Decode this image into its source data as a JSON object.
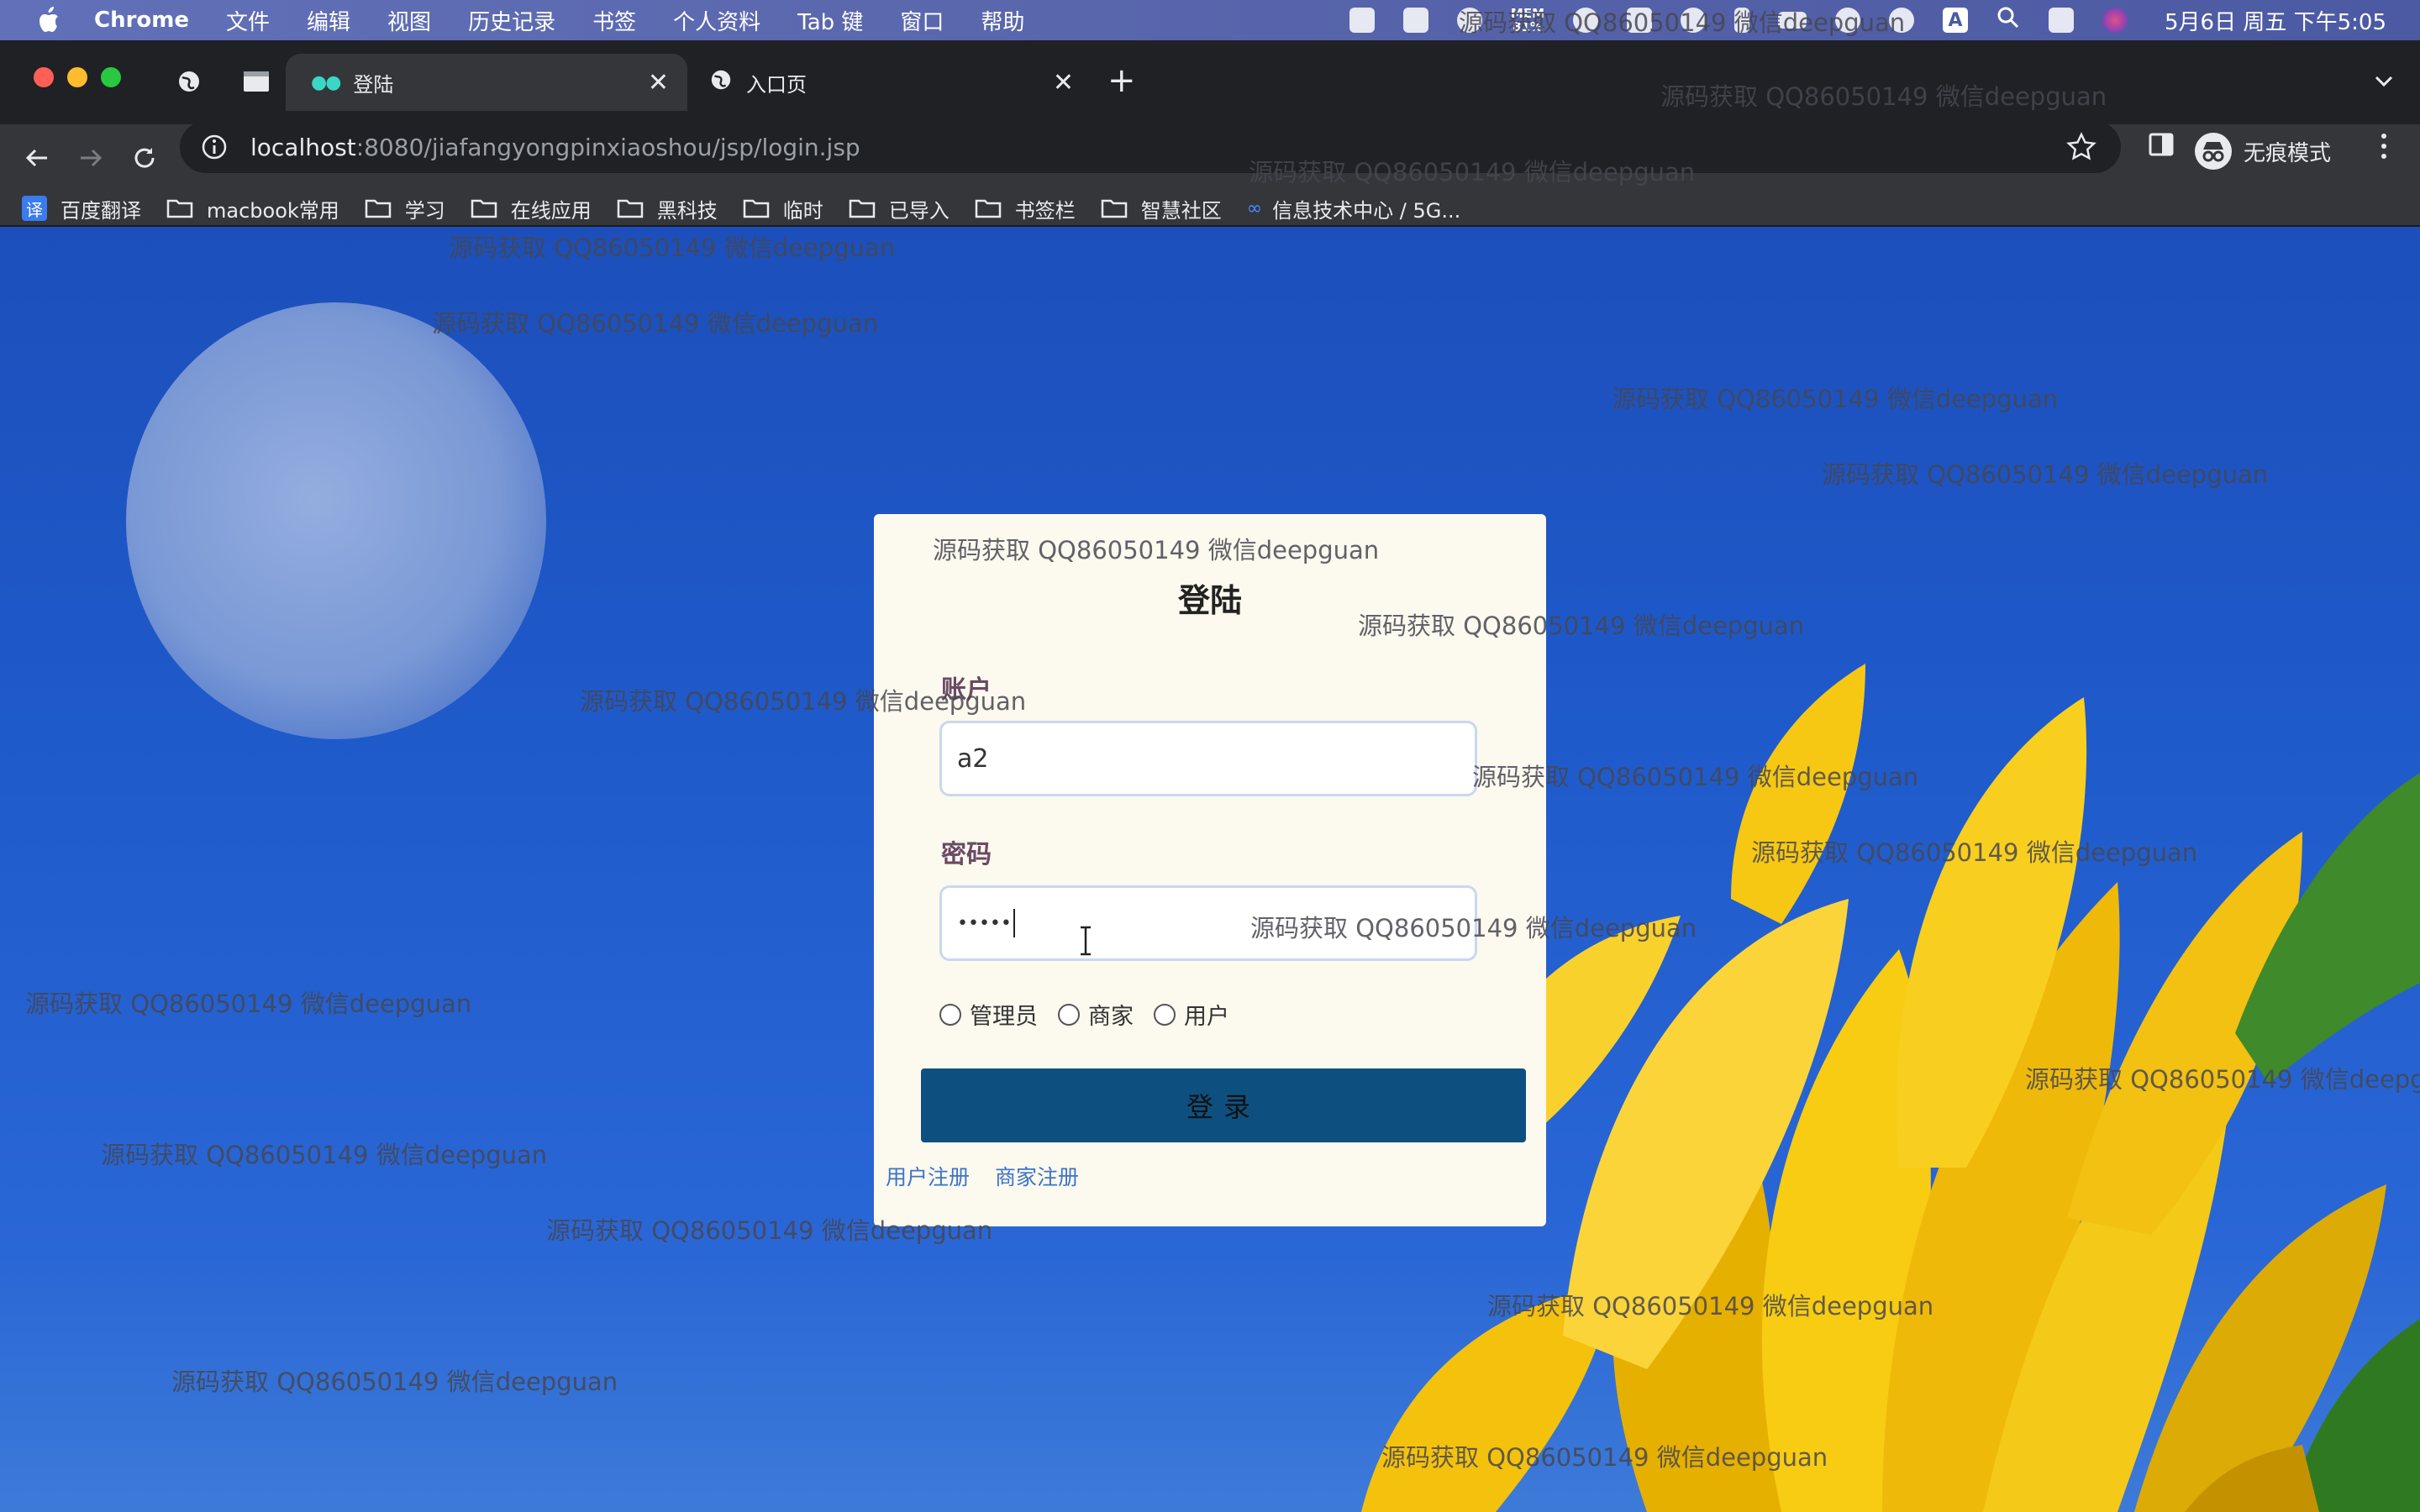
{
  "menubar": {
    "app": "Chrome",
    "items": [
      "文件",
      "编辑",
      "视图",
      "历史记录",
      "书签",
      "个人资料",
      "Tab 键",
      "窗口",
      "帮助"
    ],
    "mem_label": "MEM",
    "mem_value": "81%",
    "input_method": "A",
    "clock": "5月6日 周五 下午5:05"
  },
  "tabs": [
    {
      "title": "登陆",
      "active": true,
      "icon": "dots-icon"
    },
    {
      "title": "入口页",
      "active": false,
      "icon": "globe-icon"
    }
  ],
  "toolbar": {
    "url_host": "localhost",
    "url_rest": ":8080/jiafangyongpinxiaoshou/jsp/login.jsp",
    "incognito_label": "无痕模式"
  },
  "bookmarks": [
    {
      "label": "百度翻译",
      "icon": "fanyi-icon",
      "badge": "译"
    },
    {
      "label": "macbook常用",
      "icon": "folder-icon"
    },
    {
      "label": "学习",
      "icon": "folder-icon"
    },
    {
      "label": "在线应用",
      "icon": "folder-icon"
    },
    {
      "label": "黑科技",
      "icon": "folder-icon"
    },
    {
      "label": "临时",
      "icon": "folder-icon"
    },
    {
      "label": "已导入",
      "icon": "folder-icon"
    },
    {
      "label": "书签栏",
      "icon": "folder-icon"
    },
    {
      "label": "智慧社区",
      "icon": "folder-icon"
    },
    {
      "label": "信息技术中心 / 5G...",
      "icon": "infinity-icon",
      "glyph": "∞"
    }
  ],
  "login": {
    "title": "登陆",
    "account_label": "账户",
    "account_value": "a2",
    "password_label": "密码",
    "password_value": "•••••",
    "roles": [
      "管理员",
      "商家",
      "用户"
    ],
    "submit_label": "登录",
    "links": [
      "用户注册",
      "商家注册"
    ]
  },
  "watermark": "源码获取 QQ86050149 微信deepguan",
  "colors": {
    "menubar": "#5a67ad",
    "tabstrip": "#202124",
    "toolbar": "#35363a",
    "sky": "#1f5acb",
    "card": "#fcf9ee",
    "button": "#0d5080",
    "link": "#3b74c9",
    "label": "#6a4a64"
  }
}
